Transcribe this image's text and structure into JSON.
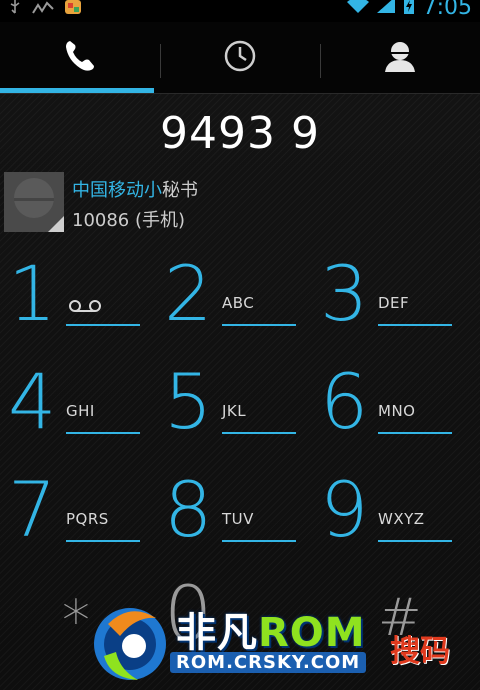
{
  "status_bar": {
    "time": "7:05",
    "icons": [
      "usb-icon",
      "activity-icon",
      "app-notification-icon",
      "wifi-icon",
      "signal-icon",
      "battery-charging-icon"
    ]
  },
  "tabs": [
    {
      "name": "phone",
      "icon": "phone-icon",
      "active": true
    },
    {
      "name": "recent",
      "icon": "clock-icon",
      "active": false
    },
    {
      "name": "contacts",
      "icon": "person-icon",
      "active": false
    }
  ],
  "dial": {
    "digits": "9493 9"
  },
  "suggestion": {
    "name_highlight": "中国移动小",
    "name_rest": "秘书",
    "number": "10086 (手机)"
  },
  "keypad": {
    "keys": [
      {
        "digit": "1",
        "letters": "",
        "icon": "voicemail-icon"
      },
      {
        "digit": "2",
        "letters": "ABC"
      },
      {
        "digit": "3",
        "letters": "DEF"
      },
      {
        "digit": "4",
        "letters": "GHI"
      },
      {
        "digit": "5",
        "letters": "JKL"
      },
      {
        "digit": "6",
        "letters": "MNO"
      },
      {
        "digit": "7",
        "letters": "PQRS"
      },
      {
        "digit": "8",
        "letters": "TUV"
      },
      {
        "digit": "9",
        "letters": "WXYZ"
      },
      {
        "digit": "*",
        "letters": ""
      },
      {
        "digit": "0",
        "letters": ""
      },
      {
        "digit": "#",
        "letters": ""
      }
    ]
  },
  "watermark": {
    "brand_cn": "非凡",
    "brand_rom": "ROM",
    "url": "ROM.CRSKY.COM",
    "side_text": "搜码"
  },
  "colors": {
    "accent": "#33b5e5",
    "background": "#111111"
  }
}
